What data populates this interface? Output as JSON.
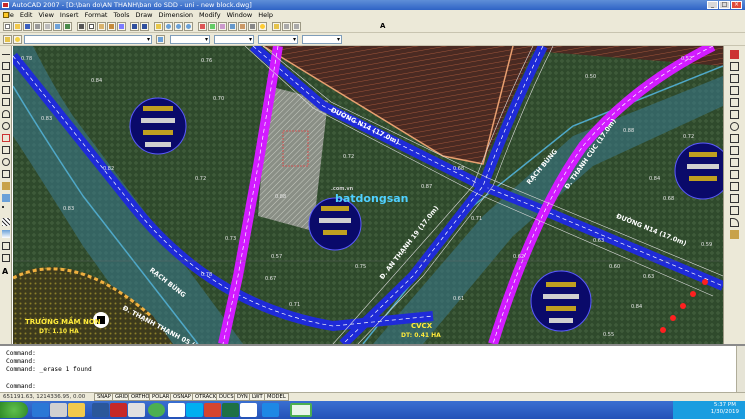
{
  "window": {
    "title": "AutoCAD 2007 - [D:\\ban do\\AN THANH\\ban do SDD - uni - new block.dwg]",
    "controls": [
      "_",
      "□",
      "×"
    ]
  },
  "menu": {
    "items": [
      "File",
      "Edit",
      "View",
      "Insert",
      "Format",
      "Tools",
      "Draw",
      "Dimension",
      "Modify",
      "Window",
      "Help"
    ]
  },
  "toolbar": {
    "text_style_label": "A"
  },
  "drawing": {
    "road_labels": {
      "duong_n14_top": "ĐƯỜNG N14 (17.0m)",
      "rach_bung_top": "RẠCH BÙNG",
      "thanh_cuc": "Đ. THANH CÚC (17.0m)",
      "duong_n14_right": "ĐƯỜNG N14 (17.0m)",
      "an_thanh_19": "Đ. AN THẠNH 19 (17.0m)",
      "rach_bung_left": "RẠCH BÙNG",
      "thanh_thanh": "Đ. THẠNH THẠNH 05 (15.0m)"
    },
    "zones": {
      "truong_mam_non": "TRƯỜNG MẦM NON",
      "truong_area": "DT: 1.10 HA",
      "cvcx": "CVCX",
      "cvcx_area": "DT: 0.41 HA"
    },
    "elevations": [
      "0.78",
      "0.84",
      "0.83",
      "0.76",
      "0.70",
      "0.82",
      "0.72",
      "0.83",
      "0.72",
      "0.88",
      "0.87",
      "0.68",
      "0.50",
      "0.52",
      "0.88",
      "0.84",
      "0.72",
      "0.71",
      "0.68",
      "0.57",
      "0.78",
      "0.75",
      "0.73",
      "0.63",
      "0.60",
      "0.63",
      "0.84",
      "0.71",
      "0.67",
      "0.61",
      "0.62",
      "0.55",
      "0.59"
    ],
    "watermark": "batdongsan",
    "watermark_sub": ".com.vn"
  },
  "command": {
    "lines": [
      "Command:",
      "Command:",
      "Command: _erase 1 found",
      "",
      "Command:"
    ]
  },
  "status": {
    "coordinates": "651191.63, 1214336.95, 0.00",
    "buttons": [
      "SNAP",
      "GRID",
      "ORTHO",
      "POLAR",
      "OSNAP",
      "OTRACK",
      "DUCS",
      "DYN",
      "LWT",
      "MODEL"
    ]
  },
  "taskbar": {
    "apps": [
      "start",
      "ie-icon",
      "cad-icon",
      "folder-icon",
      "word-icon",
      "acrobat-icon",
      "media-icon",
      "zalo-icon",
      "chrome-icon",
      "skype-icon",
      "network-icon",
      "excel-icon",
      "ps-icon",
      "autocad-icon"
    ],
    "time": "5:37 PM",
    "date": "1/30/2019"
  },
  "colors": {
    "road_blue": "#1f2bd8",
    "road_magenta": "#d21cff",
    "river_cyan": "#4fa8c8",
    "land_green": "#3b5a38"
  }
}
